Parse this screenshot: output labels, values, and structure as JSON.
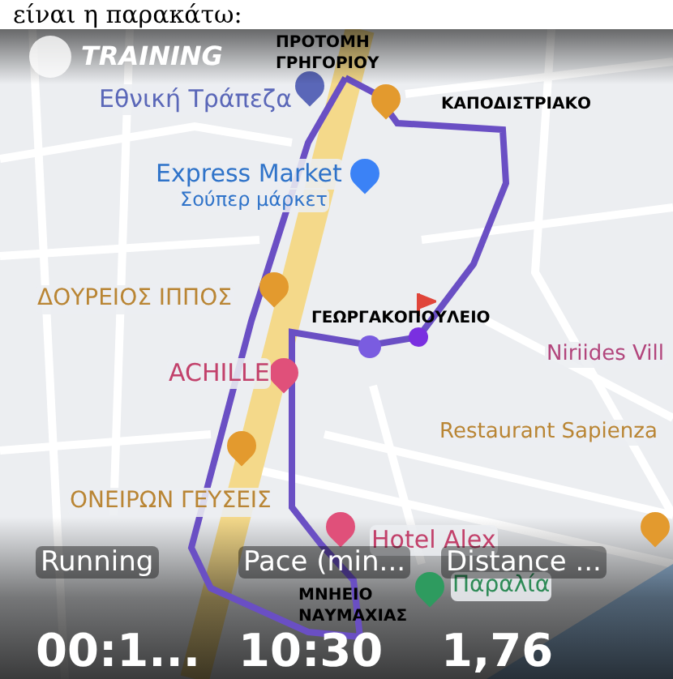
{
  "caption": "είναι η παρακάτω:",
  "brand": "TRAINING",
  "map_labels": [
    {
      "text": "Εθνική Τράπεζα",
      "color": "#5a67b8"
    },
    {
      "text": "Express Market",
      "color": "#2f73c9"
    },
    {
      "text": "Σούπερ μάρκετ",
      "color": "#2f73c9"
    },
    {
      "text": "ΔΟΥΡΕΙΟΣ ΙΠΠΟΣ",
      "color": "#b98534"
    },
    {
      "text": "Niriides Vill",
      "color": "#b2457c"
    },
    {
      "text": "ACHILLE",
      "color": "#c2416b"
    },
    {
      "text": "Restaurant Sapienza",
      "color": "#b98534"
    },
    {
      "text": "ΟΝΕΙΡΩΝ ΓΕΥΣΕΙΣ",
      "color": "#b98534"
    },
    {
      "text": "Hotel Alex",
      "color": "#c2416b"
    },
    {
      "text": "Παραλία",
      "color": "#2e8b57"
    }
  ],
  "landmarks": [
    "ΠΡΟΤΟΜΗ ΓΡΗΓΟΡΙΟΥ",
    "ΚΑΠΟΔΙΣΤΡΙΑΚΟ",
    "ΓΕΩΡΓΑΚΟΠΟΥΛΕΙΟ",
    "ΜΝΗΕΙΟ ΝΑΥΜΑΧΙΑΣ"
  ],
  "stats": [
    {
      "label": "Running",
      "value": "00:1..."
    },
    {
      "label": "Pace (min...",
      "value": "10:30"
    },
    {
      "label": "Distance ...",
      "value": "1,76"
    }
  ]
}
